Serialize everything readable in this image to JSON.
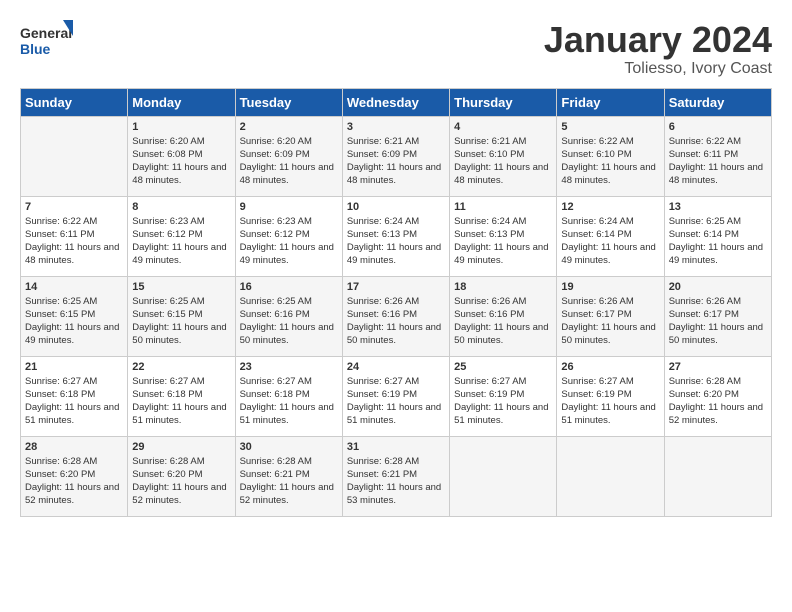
{
  "logo": {
    "line1": "General",
    "line2": "Blue"
  },
  "title": "January 2024",
  "subtitle": "Toliesso, Ivory Coast",
  "weekdays": [
    "Sunday",
    "Monday",
    "Tuesday",
    "Wednesday",
    "Thursday",
    "Friday",
    "Saturday"
  ],
  "weeks": [
    [
      {
        "day": "",
        "sunrise": "",
        "sunset": "",
        "daylight": ""
      },
      {
        "day": "1",
        "sunrise": "Sunrise: 6:20 AM",
        "sunset": "Sunset: 6:08 PM",
        "daylight": "Daylight: 11 hours and 48 minutes."
      },
      {
        "day": "2",
        "sunrise": "Sunrise: 6:20 AM",
        "sunset": "Sunset: 6:09 PM",
        "daylight": "Daylight: 11 hours and 48 minutes."
      },
      {
        "day": "3",
        "sunrise": "Sunrise: 6:21 AM",
        "sunset": "Sunset: 6:09 PM",
        "daylight": "Daylight: 11 hours and 48 minutes."
      },
      {
        "day": "4",
        "sunrise": "Sunrise: 6:21 AM",
        "sunset": "Sunset: 6:10 PM",
        "daylight": "Daylight: 11 hours and 48 minutes."
      },
      {
        "day": "5",
        "sunrise": "Sunrise: 6:22 AM",
        "sunset": "Sunset: 6:10 PM",
        "daylight": "Daylight: 11 hours and 48 minutes."
      },
      {
        "day": "6",
        "sunrise": "Sunrise: 6:22 AM",
        "sunset": "Sunset: 6:11 PM",
        "daylight": "Daylight: 11 hours and 48 minutes."
      }
    ],
    [
      {
        "day": "7",
        "sunrise": "Sunrise: 6:22 AM",
        "sunset": "Sunset: 6:11 PM",
        "daylight": "Daylight: 11 hours and 48 minutes."
      },
      {
        "day": "8",
        "sunrise": "Sunrise: 6:23 AM",
        "sunset": "Sunset: 6:12 PM",
        "daylight": "Daylight: 11 hours and 49 minutes."
      },
      {
        "day": "9",
        "sunrise": "Sunrise: 6:23 AM",
        "sunset": "Sunset: 6:12 PM",
        "daylight": "Daylight: 11 hours and 49 minutes."
      },
      {
        "day": "10",
        "sunrise": "Sunrise: 6:24 AM",
        "sunset": "Sunset: 6:13 PM",
        "daylight": "Daylight: 11 hours and 49 minutes."
      },
      {
        "day": "11",
        "sunrise": "Sunrise: 6:24 AM",
        "sunset": "Sunset: 6:13 PM",
        "daylight": "Daylight: 11 hours and 49 minutes."
      },
      {
        "day": "12",
        "sunrise": "Sunrise: 6:24 AM",
        "sunset": "Sunset: 6:14 PM",
        "daylight": "Daylight: 11 hours and 49 minutes."
      },
      {
        "day": "13",
        "sunrise": "Sunrise: 6:25 AM",
        "sunset": "Sunset: 6:14 PM",
        "daylight": "Daylight: 11 hours and 49 minutes."
      }
    ],
    [
      {
        "day": "14",
        "sunrise": "Sunrise: 6:25 AM",
        "sunset": "Sunset: 6:15 PM",
        "daylight": "Daylight: 11 hours and 49 minutes."
      },
      {
        "day": "15",
        "sunrise": "Sunrise: 6:25 AM",
        "sunset": "Sunset: 6:15 PM",
        "daylight": "Daylight: 11 hours and 50 minutes."
      },
      {
        "day": "16",
        "sunrise": "Sunrise: 6:25 AM",
        "sunset": "Sunset: 6:16 PM",
        "daylight": "Daylight: 11 hours and 50 minutes."
      },
      {
        "day": "17",
        "sunrise": "Sunrise: 6:26 AM",
        "sunset": "Sunset: 6:16 PM",
        "daylight": "Daylight: 11 hours and 50 minutes."
      },
      {
        "day": "18",
        "sunrise": "Sunrise: 6:26 AM",
        "sunset": "Sunset: 6:16 PM",
        "daylight": "Daylight: 11 hours and 50 minutes."
      },
      {
        "day": "19",
        "sunrise": "Sunrise: 6:26 AM",
        "sunset": "Sunset: 6:17 PM",
        "daylight": "Daylight: 11 hours and 50 minutes."
      },
      {
        "day": "20",
        "sunrise": "Sunrise: 6:26 AM",
        "sunset": "Sunset: 6:17 PM",
        "daylight": "Daylight: 11 hours and 50 minutes."
      }
    ],
    [
      {
        "day": "21",
        "sunrise": "Sunrise: 6:27 AM",
        "sunset": "Sunset: 6:18 PM",
        "daylight": "Daylight: 11 hours and 51 minutes."
      },
      {
        "day": "22",
        "sunrise": "Sunrise: 6:27 AM",
        "sunset": "Sunset: 6:18 PM",
        "daylight": "Daylight: 11 hours and 51 minutes."
      },
      {
        "day": "23",
        "sunrise": "Sunrise: 6:27 AM",
        "sunset": "Sunset: 6:18 PM",
        "daylight": "Daylight: 11 hours and 51 minutes."
      },
      {
        "day": "24",
        "sunrise": "Sunrise: 6:27 AM",
        "sunset": "Sunset: 6:19 PM",
        "daylight": "Daylight: 11 hours and 51 minutes."
      },
      {
        "day": "25",
        "sunrise": "Sunrise: 6:27 AM",
        "sunset": "Sunset: 6:19 PM",
        "daylight": "Daylight: 11 hours and 51 minutes."
      },
      {
        "day": "26",
        "sunrise": "Sunrise: 6:27 AM",
        "sunset": "Sunset: 6:19 PM",
        "daylight": "Daylight: 11 hours and 51 minutes."
      },
      {
        "day": "27",
        "sunrise": "Sunrise: 6:28 AM",
        "sunset": "Sunset: 6:20 PM",
        "daylight": "Daylight: 11 hours and 52 minutes."
      }
    ],
    [
      {
        "day": "28",
        "sunrise": "Sunrise: 6:28 AM",
        "sunset": "Sunset: 6:20 PM",
        "daylight": "Daylight: 11 hours and 52 minutes."
      },
      {
        "day": "29",
        "sunrise": "Sunrise: 6:28 AM",
        "sunset": "Sunset: 6:20 PM",
        "daylight": "Daylight: 11 hours and 52 minutes."
      },
      {
        "day": "30",
        "sunrise": "Sunrise: 6:28 AM",
        "sunset": "Sunset: 6:21 PM",
        "daylight": "Daylight: 11 hours and 52 minutes."
      },
      {
        "day": "31",
        "sunrise": "Sunrise: 6:28 AM",
        "sunset": "Sunset: 6:21 PM",
        "daylight": "Daylight: 11 hours and 53 minutes."
      },
      {
        "day": "",
        "sunrise": "",
        "sunset": "",
        "daylight": ""
      },
      {
        "day": "",
        "sunrise": "",
        "sunset": "",
        "daylight": ""
      },
      {
        "day": "",
        "sunrise": "",
        "sunset": "",
        "daylight": ""
      }
    ]
  ]
}
